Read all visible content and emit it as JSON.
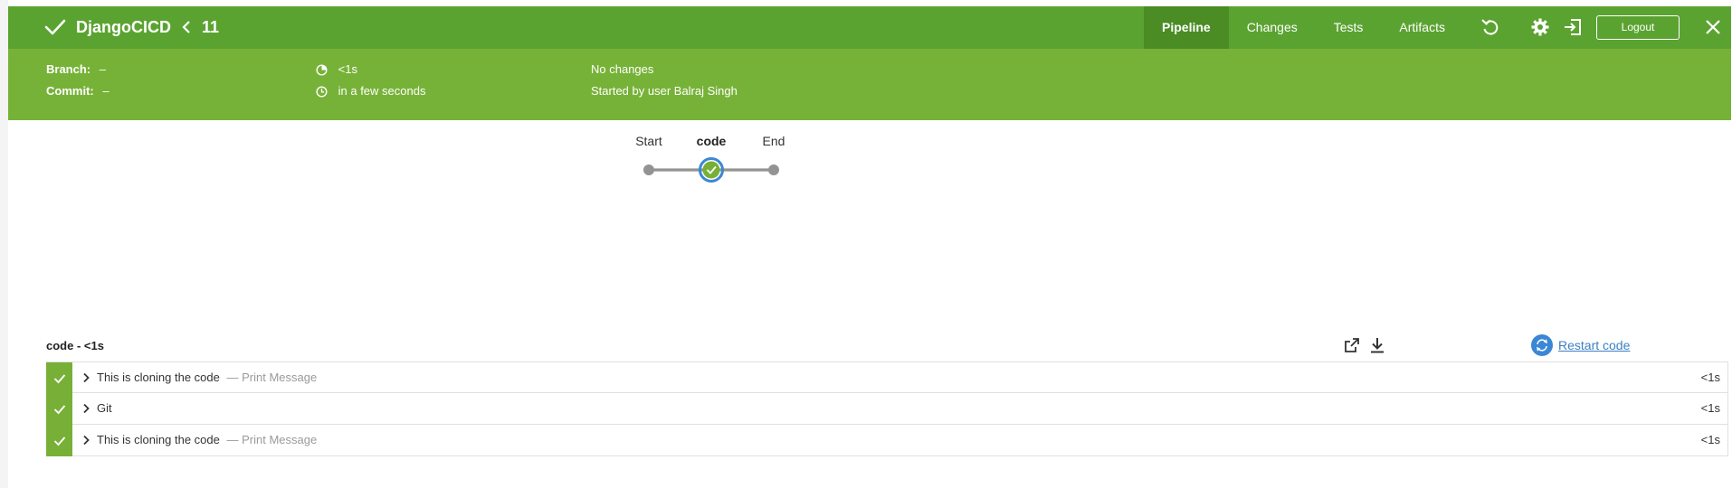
{
  "header": {
    "title": "DjangoCICD",
    "run_number": "11",
    "tabs": [
      {
        "label": "Pipeline",
        "active": true
      },
      {
        "label": "Changes",
        "active": false
      },
      {
        "label": "Tests",
        "active": false
      },
      {
        "label": "Artifacts",
        "active": false
      }
    ],
    "logout_label": "Logout",
    "icons": [
      "checkmark-icon",
      "chevron-left-icon",
      "replay-icon",
      "gear-icon",
      "exit-icon",
      "close-icon"
    ]
  },
  "info": {
    "branch_label": "Branch:",
    "branch_value": "–",
    "commit_label": "Commit:",
    "commit_value": "–",
    "duration": "<1s",
    "time": "in a few seconds",
    "changes": "No changes",
    "started_by": "Started by user Balraj Singh"
  },
  "graph": {
    "nodes": [
      {
        "label": "Start",
        "status": "none"
      },
      {
        "label": "code",
        "status": "success",
        "selected": true
      },
      {
        "label": "End",
        "status": "none"
      }
    ]
  },
  "steps_panel": {
    "title": "code - <1s",
    "restart_label": "Restart code",
    "steps": [
      {
        "text": "This is cloning the code",
        "sub": "— Print Message",
        "duration": "<1s",
        "status": "success"
      },
      {
        "text": "Git",
        "sub": "",
        "duration": "<1s",
        "status": "success"
      },
      {
        "text": "This is cloning the code",
        "sub": "— Print Message",
        "duration": "<1s",
        "status": "success"
      }
    ]
  },
  "colors": {
    "topbar": "#5ba331",
    "infobar": "#77b238",
    "active_tab": "#4b8c25",
    "success": "#78b037",
    "selected_ring": "#3b87d6",
    "link": "#3b7fc4"
  }
}
